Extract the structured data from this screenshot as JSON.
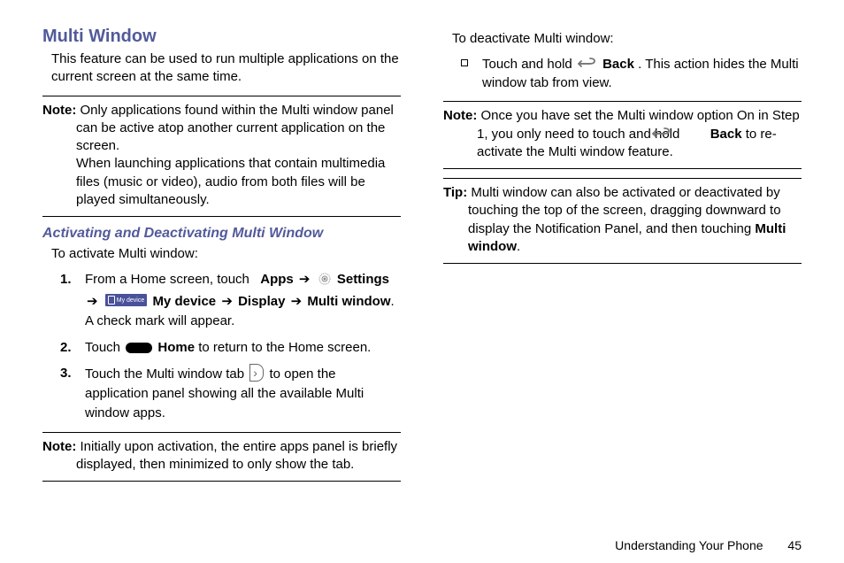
{
  "left": {
    "title": "Multi Window",
    "intro": "This feature can be used to run multiple applications on the current screen at the same time.",
    "note1_label": "Note:",
    "note1_p1": "Only applications found within the Multi window panel can be active atop another current application on the screen.",
    "note1_p2": "When launching applications that contain multimedia files (music or video), audio from both files will be played simultaneously.",
    "sub_title": "Activating and Deactivating Multi Window",
    "activate_label": "To activate Multi window:",
    "step1_pre": "From a Home screen, touch ",
    "apps": "Apps",
    "arrow": "➔",
    "settings": "Settings",
    "mydevice": "My device",
    "display": "Display",
    "multiwindow": "Multi window",
    "step1_post": "A check mark will appear.",
    "step2_pre": "Touch ",
    "home": "Home",
    "step2_post": " to return to the Home screen.",
    "step3_pre": "Touch the Multi window tab ",
    "step3_post": " to open the application panel showing all the available Multi window apps.",
    "note2_label": "Note:",
    "note2_body": "Initially upon activation, the entire apps panel is briefly displayed, then minimized to only show the tab."
  },
  "right": {
    "deactivate_label": "To deactivate Multi window:",
    "bullet_pre": "Touch and hold ",
    "back": "Back",
    "bullet_post": ". This action hides the Multi window tab from view.",
    "note_label": "Note:",
    "note_p1a": "Once you have set the Multi window option On in Step 1, you only need to touch and hold ",
    "note_p1b": " to re-activate the Multi window feature.",
    "tip_label": "Tip:",
    "tip_p1": "Multi window can also be activated or deactivated by touching the top of the screen, dragging downward to display the Notification Panel, and then touching ",
    "tip_bold": "Multi window",
    "tip_end": "."
  },
  "footer": {
    "section": "Understanding Your Phone",
    "page": "45"
  },
  "icons": {
    "mydevice_text": "My device"
  }
}
